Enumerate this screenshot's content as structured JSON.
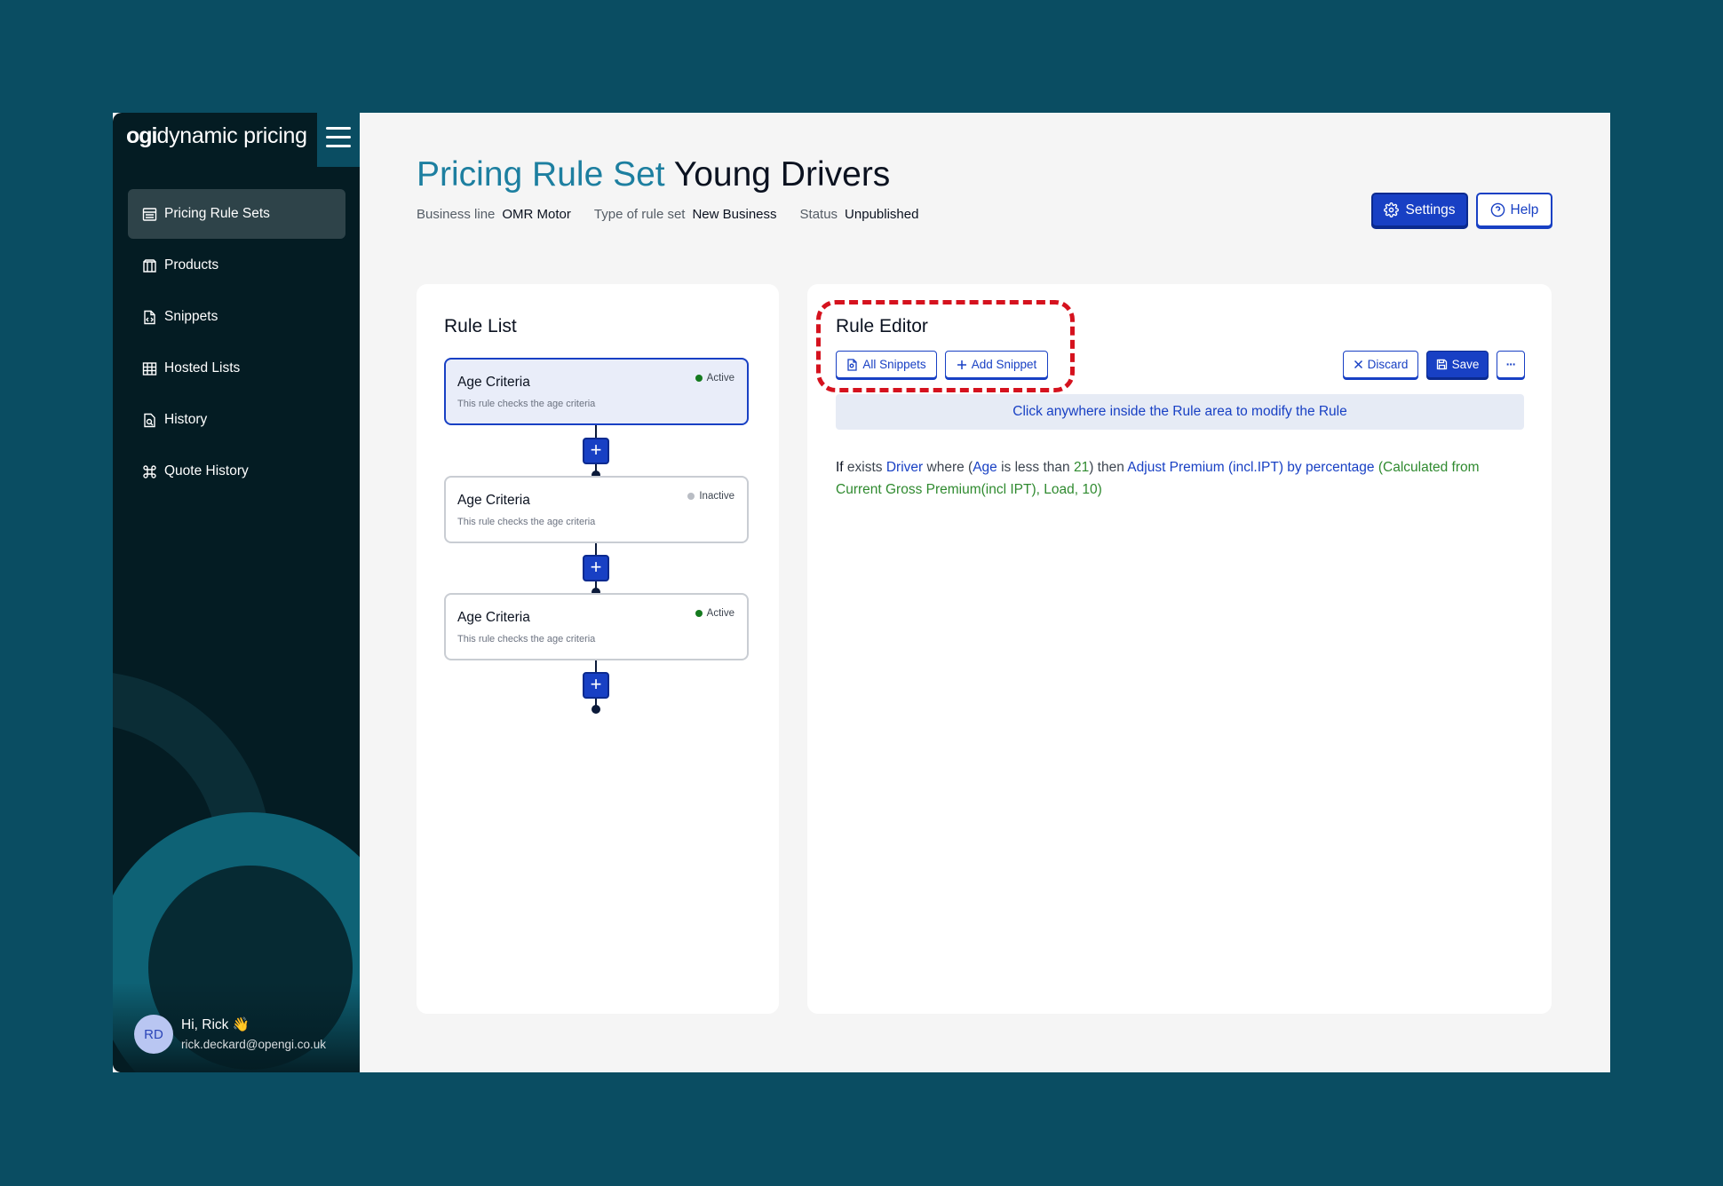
{
  "brand": {
    "ogi": "ogi",
    "name": "dynamic pricing"
  },
  "sidebar": {
    "items": [
      {
        "label": "Pricing Rule Sets",
        "icon": "list-icon",
        "active": true
      },
      {
        "label": "Products",
        "icon": "box-icon",
        "active": false
      },
      {
        "label": "Snippets",
        "icon": "code-file-icon",
        "active": false
      },
      {
        "label": "Hosted Lists",
        "icon": "table-icon",
        "active": false
      },
      {
        "label": "History",
        "icon": "history-icon",
        "active": false
      },
      {
        "label": "Quote History",
        "icon": "command-icon",
        "active": false
      }
    ],
    "user": {
      "initials": "RD",
      "greeting": "Hi, Rick 👋",
      "email": "rick.deckard@opengi.co.uk"
    }
  },
  "header": {
    "title_prefix": "Pricing Rule Set",
    "title_name": "Young Drivers",
    "meta": [
      {
        "label": "Business line",
        "value": "OMR Motor"
      },
      {
        "label": "Type of rule set",
        "value": "New Business"
      },
      {
        "label": "Status",
        "value": "Unpublished"
      }
    ],
    "settings_label": "Settings",
    "help_label": "Help"
  },
  "rule_list": {
    "title": "Rule List",
    "rules": [
      {
        "name": "Age Criteria",
        "description": "This rule checks the age criteria",
        "status": "Active"
      },
      {
        "name": "Age Criteria",
        "description": "This rule checks the age criteria",
        "status": "Inactive"
      },
      {
        "name": "Age Criteria",
        "description": "This rule checks the age criteria",
        "status": "Active"
      }
    ],
    "add_symbol": "+"
  },
  "rule_editor": {
    "title": "Rule Editor",
    "all_snippets_label": "All Snippets",
    "add_snippet_label": "Add Snippet",
    "discard_label": "Discard",
    "save_label": "Save",
    "more_label": "···",
    "hint": "Click anywhere inside the Rule area to modify the Rule",
    "rule_tokens": {
      "if": "If",
      "exists": " exists ",
      "driver": "Driver",
      "where": " where (",
      "age": "Age",
      "less_than": " is less than ",
      "value": "21",
      "then": ") then ",
      "action": "Adjust Premium (incl.IPT) by percentage",
      "open_paren": " (",
      "args": "Calculated from Current Gross Premium(incl IPT), Load, 10",
      "close_paren": ")"
    }
  },
  "colors": {
    "accent": "#1840c4",
    "title_teal": "#1d7fa0",
    "sidebar_bg": "#041c23",
    "highlight": "#d5121e",
    "active_dot": "#157a1f"
  }
}
